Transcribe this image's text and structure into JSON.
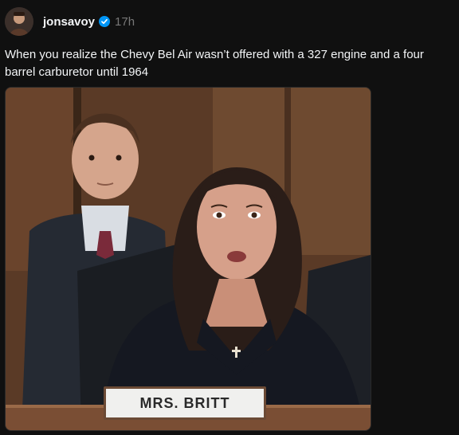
{
  "post": {
    "username": "jonsavoy",
    "timestamp": "17h",
    "caption": "When you realize the Chevy Bel Air wasn’t offered with a 327 engine and a four barrel carburetor until 1964",
    "verified_icon": "verified-badge-icon",
    "avatar_icon": "profile-avatar"
  },
  "media": {
    "nameplate_text": "MRS. BRITT"
  },
  "colors": {
    "background": "#101010",
    "text": "#f3f5f7",
    "muted": "#777777",
    "verified": "#0095f6"
  }
}
